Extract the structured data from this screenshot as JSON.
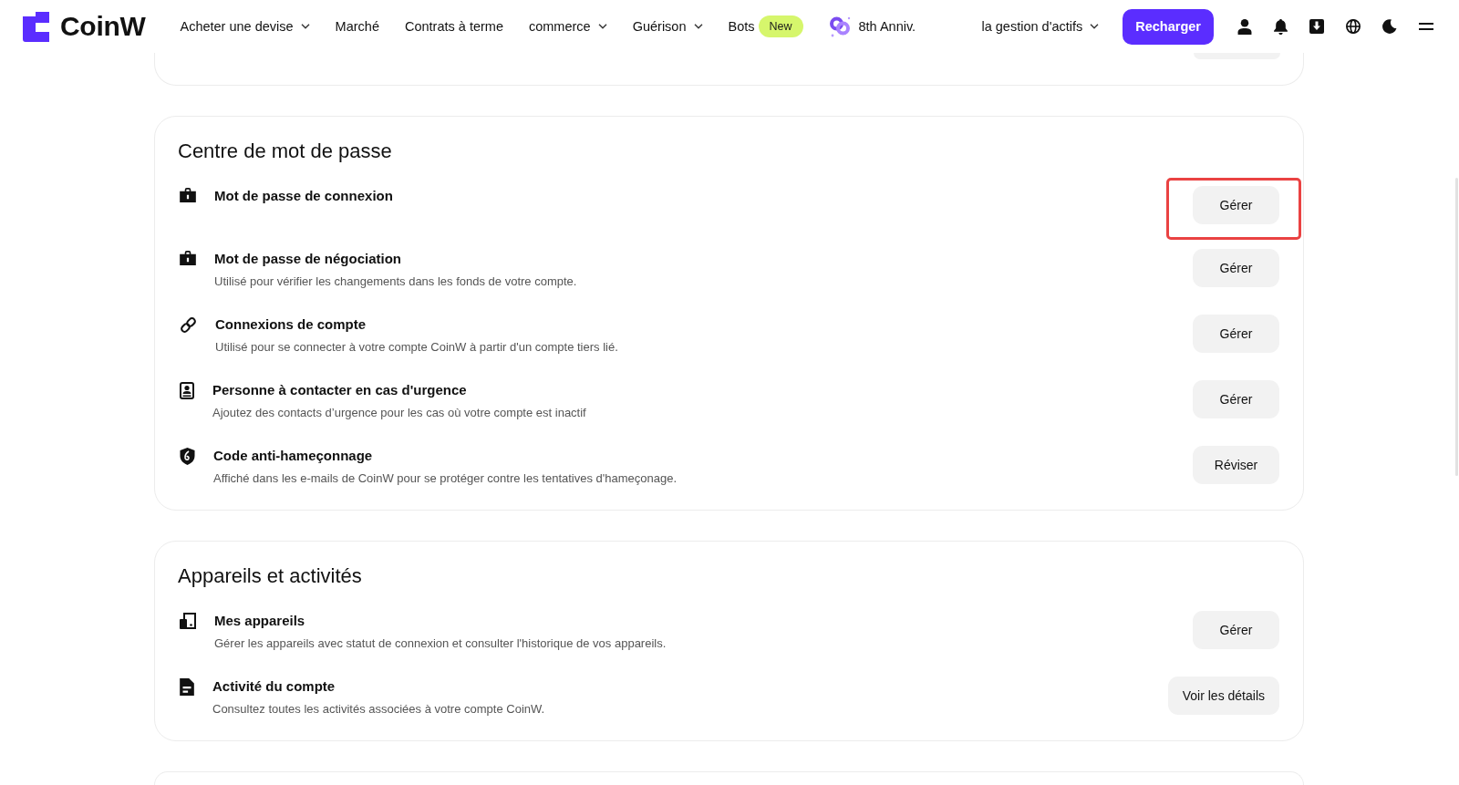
{
  "header": {
    "logo": "CoinW",
    "nav": [
      {
        "label": "Acheter une devise",
        "dropdown": true
      },
      {
        "label": "Marché",
        "dropdown": false
      },
      {
        "label": "Contrats à terme",
        "dropdown": false
      },
      {
        "label": "commerce",
        "dropdown": true
      },
      {
        "label": "Guérison",
        "dropdown": true
      },
      {
        "label": "Bots",
        "dropdown": false,
        "badge": "New"
      }
    ],
    "promo": "8th Anniv.",
    "assets_menu": {
      "label": "la gestion d'actifs",
      "dropdown": true
    },
    "deposit_button": "Recharger"
  },
  "sections": [
    {
      "title": "Centre de mot de passe",
      "rows": [
        {
          "title": "Mot de passe de connexion",
          "button": "Gérer",
          "highlighted": true
        },
        {
          "title": "Mot de passe de négociation",
          "description": "Utilisé pour vérifier les changements dans les fonds de votre compte.",
          "button": "Gérer",
          "highlighted": false
        },
        {
          "title": "Connexions de compte",
          "description": "Utilisé pour se connecter à votre compte CoinW à partir d'un compte tiers lié.",
          "button": "Gérer",
          "highlighted": false
        },
        {
          "title": "Personne à contacter en cas d'urgence",
          "description": "Ajoutez des contacts d’urgence pour les cas où votre compte est inactif",
          "button": "Gérer",
          "highlighted": false
        },
        {
          "title": "Code anti-hameçonnage",
          "description": "Affiché dans les e-mails de CoinW pour se protéger contre les tentatives d'hameçonage.",
          "button": "Réviser",
          "highlighted": false
        }
      ]
    },
    {
      "title": "Appareils et activités",
      "rows": [
        {
          "title": "Mes appareils",
          "description": "Gérer les appareils avec statut de connexion et consulter l'historique de vos appareils.",
          "button": "Gérer",
          "highlighted": false
        },
        {
          "title": "Activité du compte",
          "description": "Consultez toutes les activités associées à votre compte CoinW.",
          "button": "Voir les détails",
          "highlighted": false
        }
      ]
    }
  ]
}
